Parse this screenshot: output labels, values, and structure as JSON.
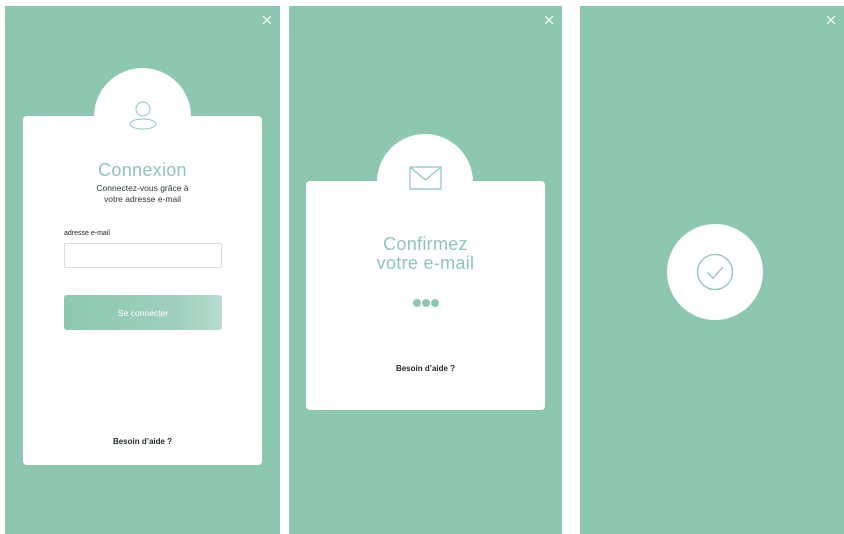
{
  "screens": {
    "login": {
      "title": "Connexion",
      "subtitle": "Connectez-vous grâce à\nvotre adresse e-mail",
      "email_label": "adresse e-mail",
      "email_value": "",
      "email_placeholder": "",
      "submit_label": "Se connecter",
      "help_label": "Besoin d’aide ?"
    },
    "confirm": {
      "title_line1": "Confirmez",
      "title_line2": "votre e-mail",
      "help_label": "Besoin d’aide ?"
    },
    "success": {}
  },
  "icons": {
    "close": "close-icon",
    "user": "user-icon",
    "envelope": "envelope-icon",
    "check": "check-circle-icon"
  },
  "colors": {
    "accent": "#8dc7b0",
    "card": "#ffffff",
    "text_dark": "#1f2a26"
  }
}
